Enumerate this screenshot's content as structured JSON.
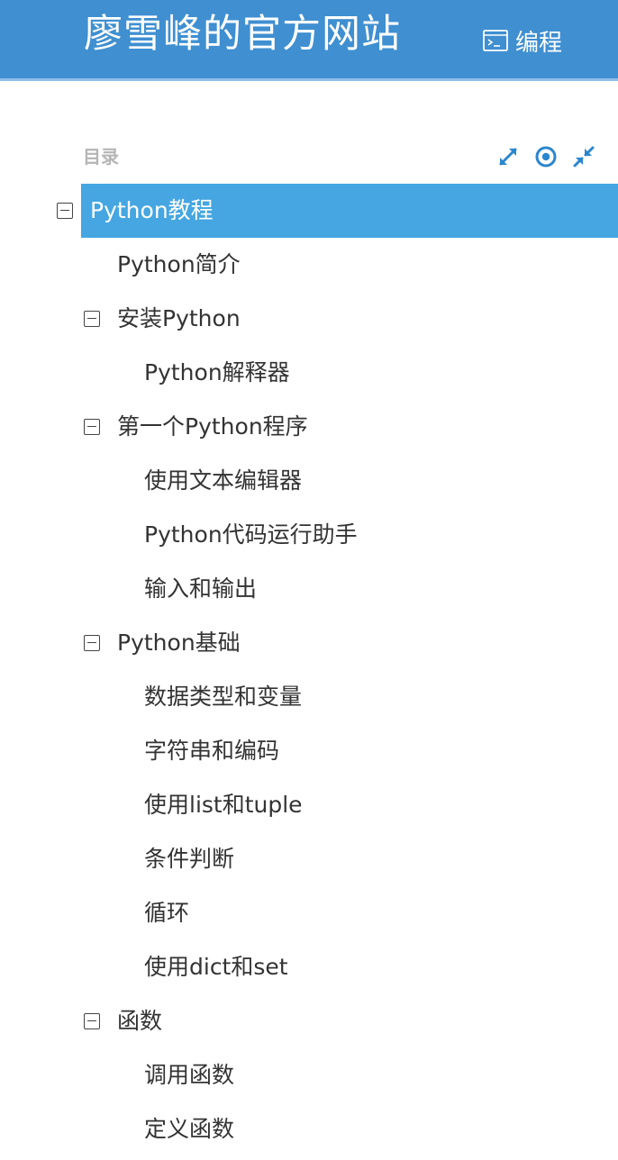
{
  "header": {
    "site_title": "廖雪峰的官方网站",
    "code_link_label": "编程",
    "code_icon": "terminal-icon",
    "background_color": "#3f8fd1"
  },
  "toc": {
    "title": "目录",
    "tools": [
      {
        "name": "expand-all-icon"
      },
      {
        "name": "locate-current-icon"
      },
      {
        "name": "collapse-all-icon"
      }
    ],
    "active_color": "#45a6e2",
    "items": [
      {
        "label": "Python教程",
        "level": 0,
        "expandable": true,
        "active": true
      },
      {
        "label": "Python简介",
        "level": 1,
        "expandable": false
      },
      {
        "label": "安装Python",
        "level": 1,
        "expandable": true
      },
      {
        "label": "Python解释器",
        "level": 2,
        "expandable": false
      },
      {
        "label": "第一个Python程序",
        "level": 1,
        "expandable": true
      },
      {
        "label": "使用文本编辑器",
        "level": 2,
        "expandable": false
      },
      {
        "label": "Python代码运行助手",
        "level": 2,
        "expandable": false
      },
      {
        "label": "输入和输出",
        "level": 2,
        "expandable": false
      },
      {
        "label": "Python基础",
        "level": 1,
        "expandable": true
      },
      {
        "label": "数据类型和变量",
        "level": 2,
        "expandable": false
      },
      {
        "label": "字符串和编码",
        "level": 2,
        "expandable": false
      },
      {
        "label": "使用list和tuple",
        "level": 2,
        "expandable": false
      },
      {
        "label": "条件判断",
        "level": 2,
        "expandable": false
      },
      {
        "label": "循环",
        "level": 2,
        "expandable": false
      },
      {
        "label": "使用dict和set",
        "level": 2,
        "expandable": false
      },
      {
        "label": "函数",
        "level": 1,
        "expandable": true
      },
      {
        "label": "调用函数",
        "level": 2,
        "expandable": false
      },
      {
        "label": "定义函数",
        "level": 2,
        "expandable": false
      }
    ]
  }
}
